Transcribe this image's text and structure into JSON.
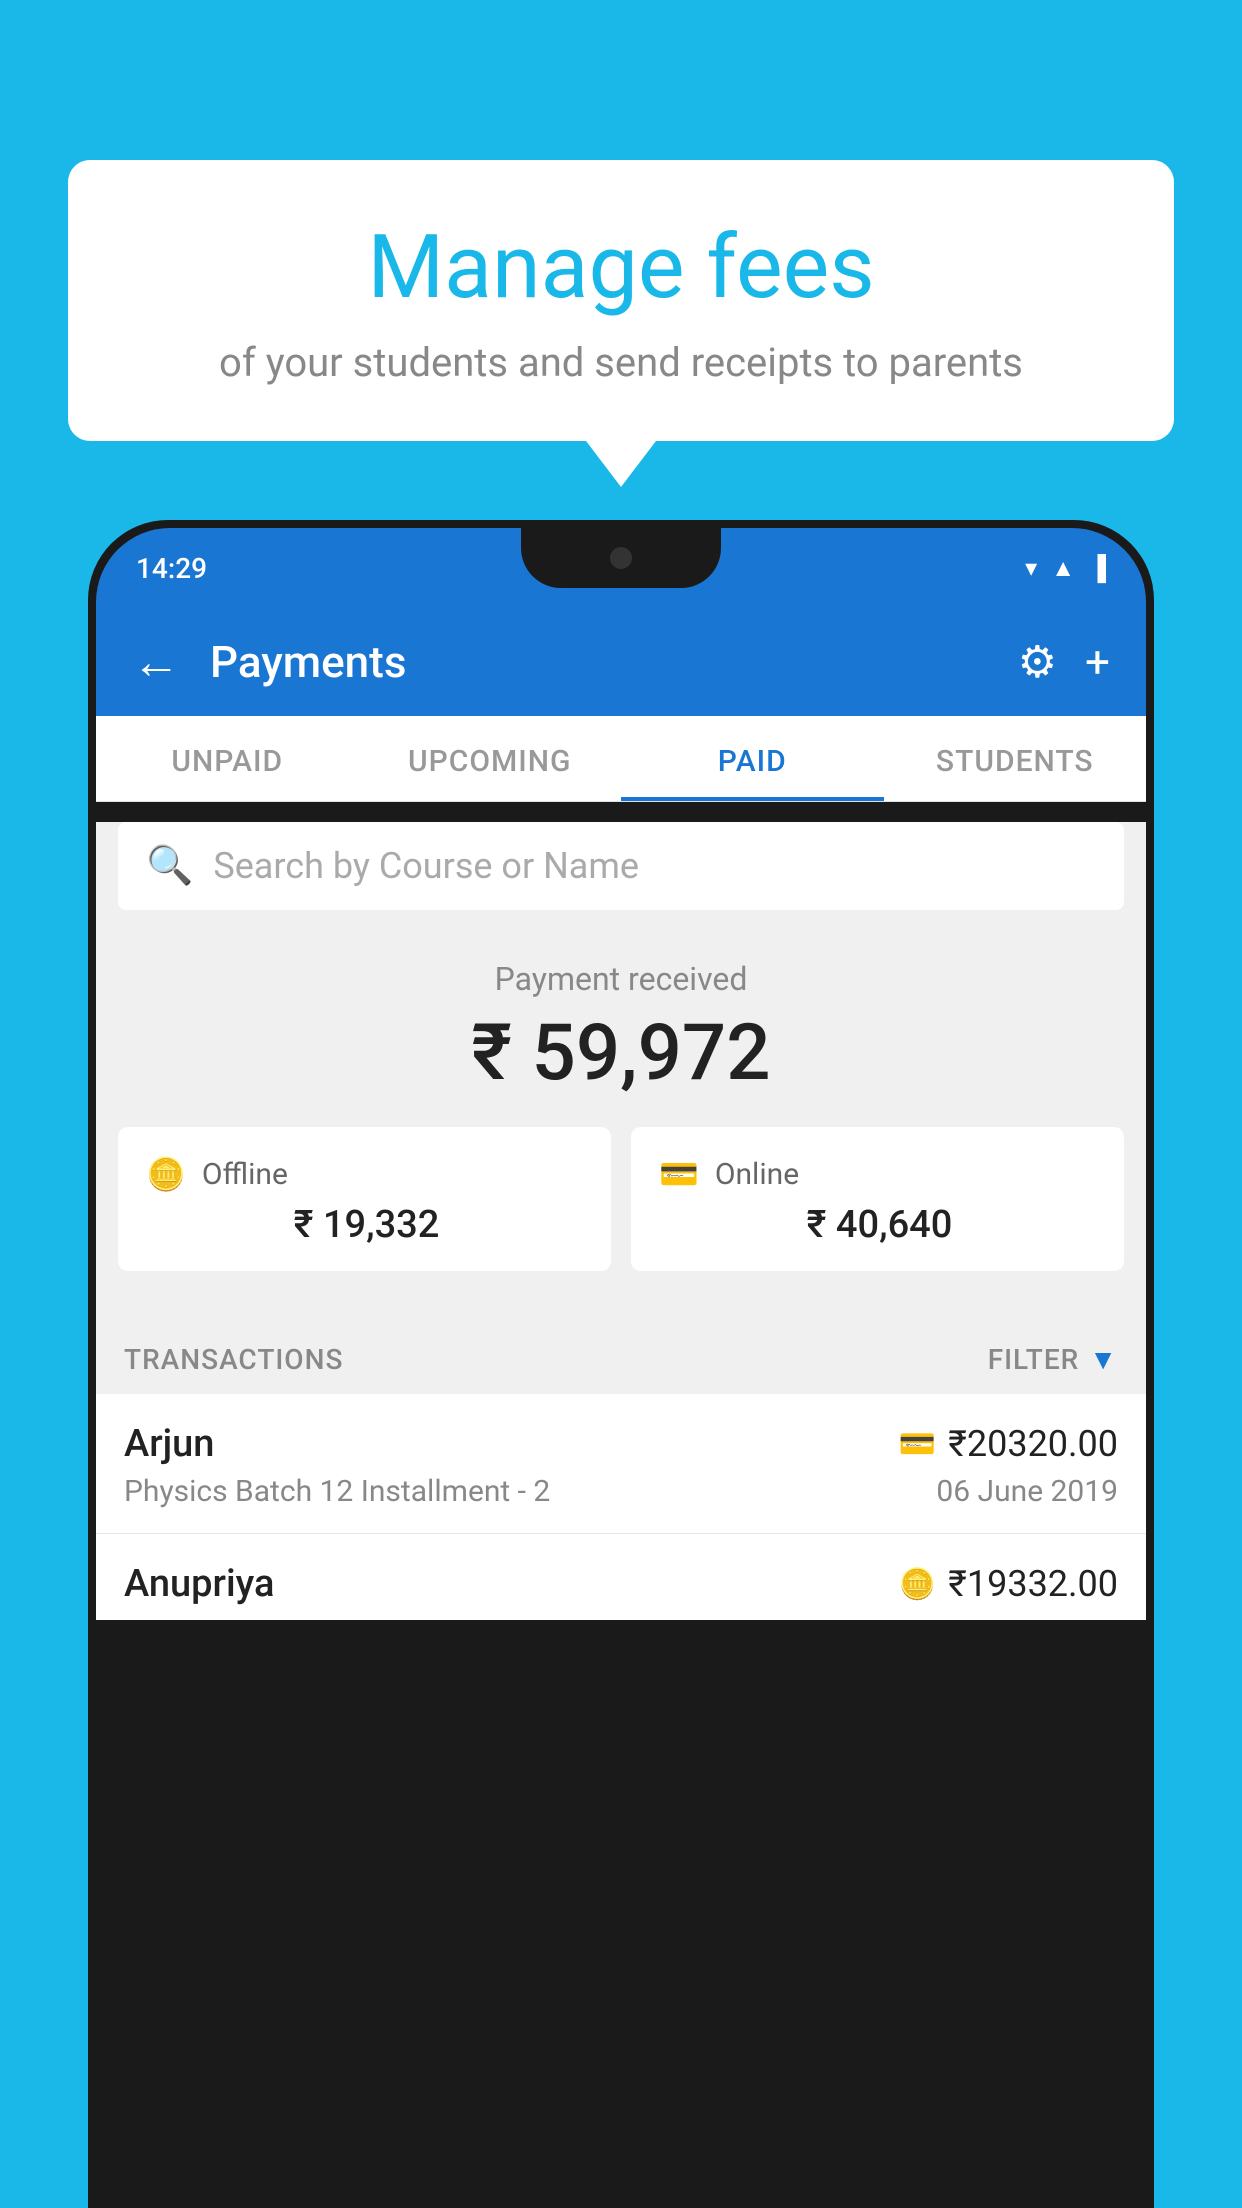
{
  "background_color": "#1ab8e8",
  "bubble": {
    "title": "Manage fees",
    "subtitle": "of your students and send receipts to parents"
  },
  "phone": {
    "status_bar": {
      "time": "14:29"
    },
    "app_bar": {
      "title": "Payments",
      "back_label": "←",
      "gear_label": "⚙",
      "plus_label": "+"
    },
    "tabs": [
      {
        "label": "UNPAID",
        "active": false
      },
      {
        "label": "UPCOMING",
        "active": false
      },
      {
        "label": "PAID",
        "active": true
      },
      {
        "label": "STUDENTS",
        "active": false
      }
    ],
    "search": {
      "placeholder": "Search by Course or Name"
    },
    "payment_summary": {
      "received_label": "Payment received",
      "total_amount": "₹ 59,972",
      "offline_label": "Offline",
      "offline_amount": "₹ 19,332",
      "online_label": "Online",
      "online_amount": "₹ 40,640"
    },
    "transactions": {
      "section_label": "TRANSACTIONS",
      "filter_label": "FILTER",
      "rows": [
        {
          "name": "Arjun",
          "course": "Physics Batch 12 Installment - 2",
          "date": "06 June 2019",
          "amount": "₹20320.00",
          "payment_type": "online"
        },
        {
          "name": "Anupriya",
          "course": "",
          "date": "",
          "amount": "₹19332.00",
          "payment_type": "offline"
        }
      ]
    }
  }
}
